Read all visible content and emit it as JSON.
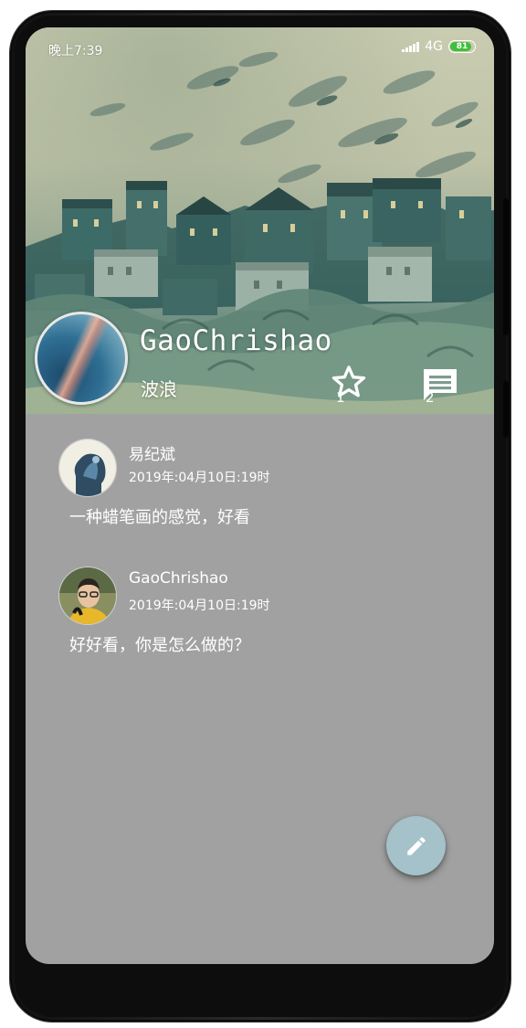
{
  "status_bar": {
    "time": "晚上7:39",
    "network": "4G",
    "battery": "81",
    "battery_level": 0.81
  },
  "profile": {
    "name": "GaoChrishao",
    "subtitle": "波浪",
    "star_icon": "star-outline-icon",
    "star_count": "1",
    "comment_icon": "comment-icon",
    "comment_count": "2"
  },
  "comments": [
    {
      "author": "易纪斌",
      "time": "2019年:04月10日:19时",
      "text": "一种蜡笔画的感觉，好看"
    },
    {
      "author": "GaoChrishao",
      "time": "2019年:04月10日:19时",
      "text": "好好看，你是怎么做的？"
    }
  ],
  "fab": {
    "icon": "pencil-edit-icon"
  },
  "colors": {
    "content_background": "#a1a1a1",
    "fab": "#a5c1c9",
    "text": "#ffffff"
  }
}
